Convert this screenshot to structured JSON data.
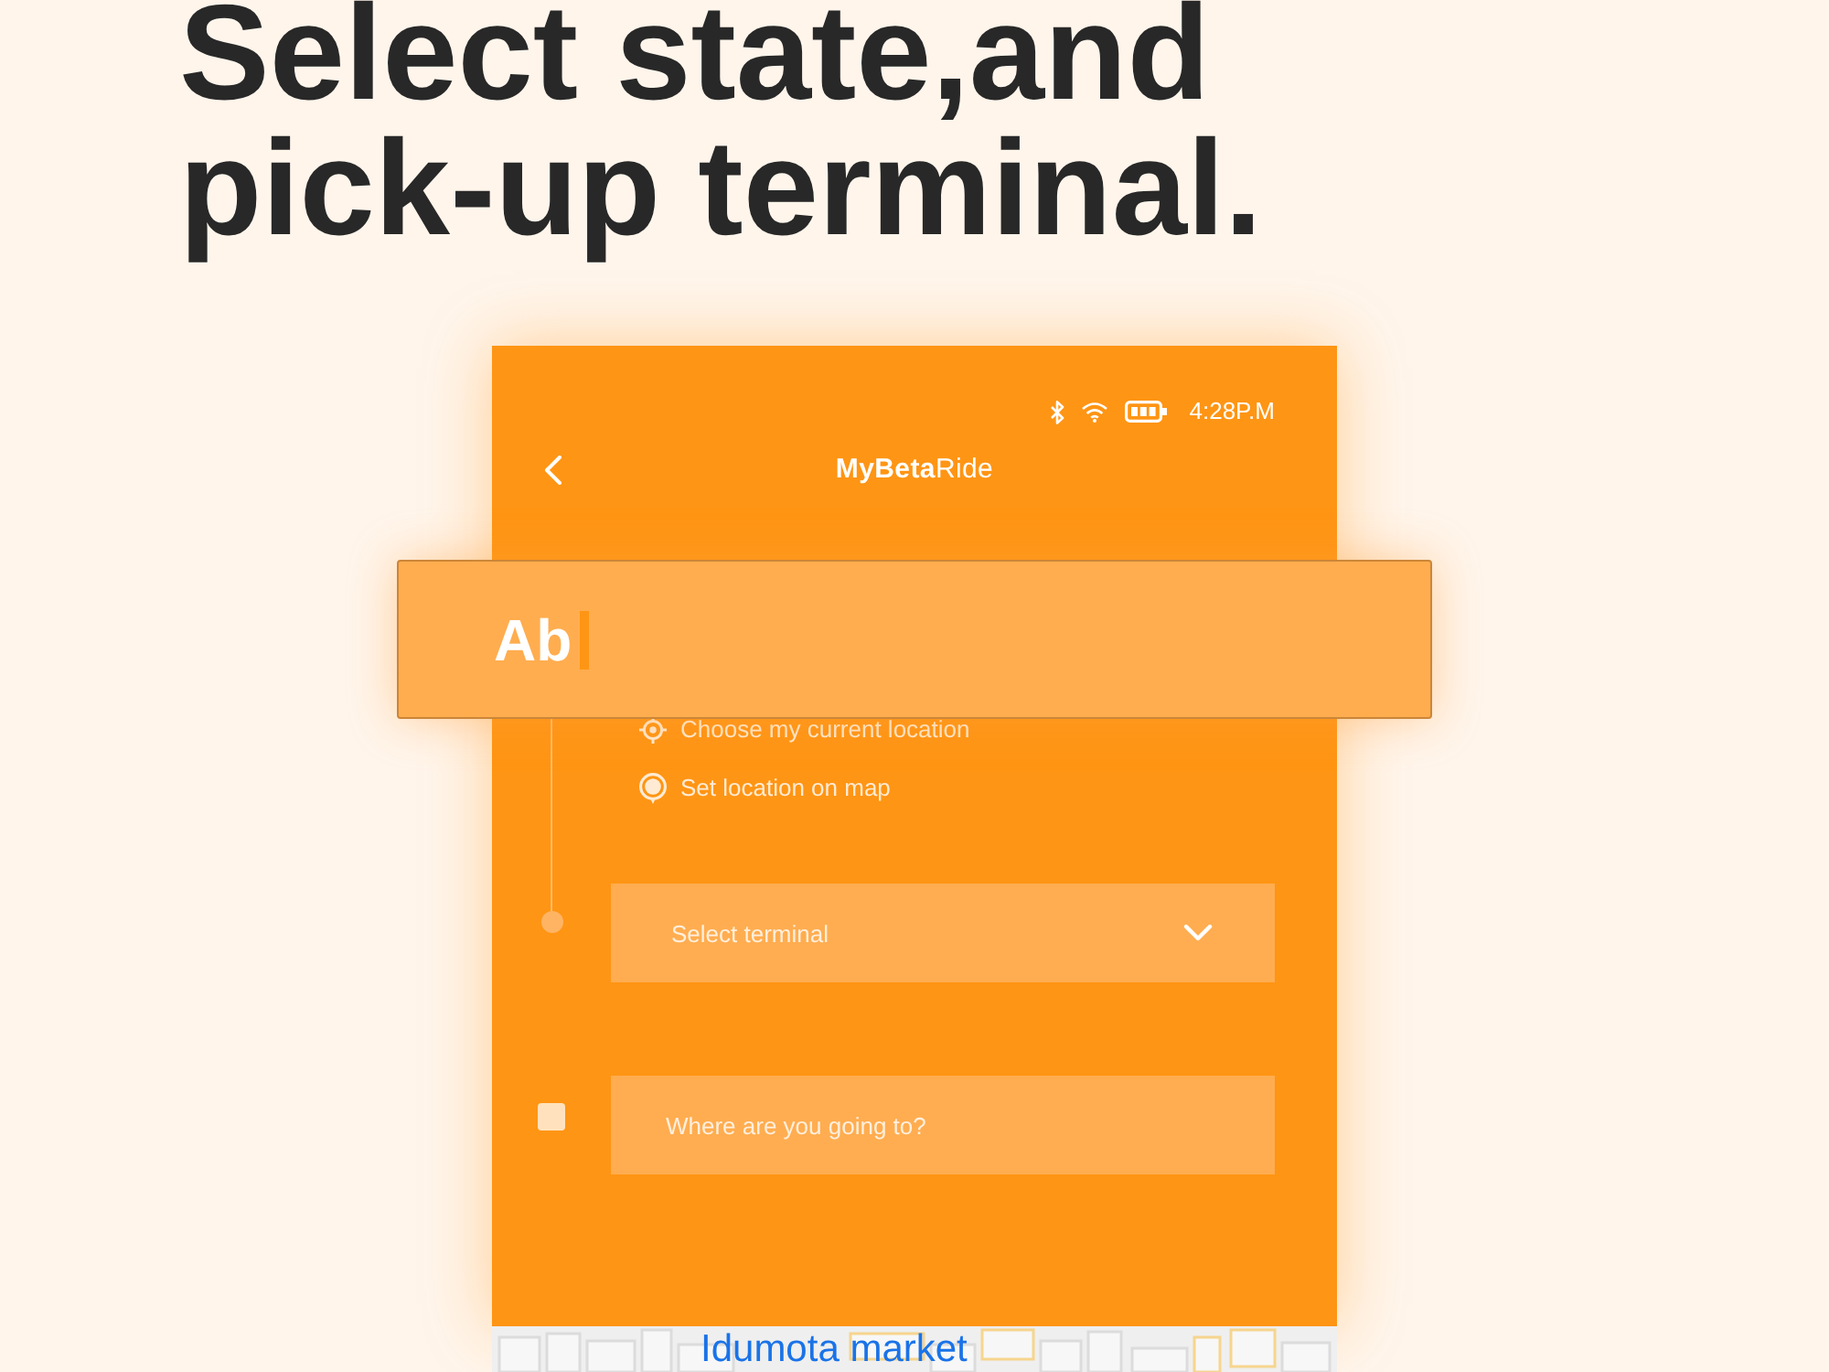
{
  "title": "Select state,and pick-up terminal.",
  "status_bar": {
    "time": "4:28P.M"
  },
  "app_bar": {
    "logo": "**MyBeta**Ride"
  },
  "search_field": {
    "value": "Ab",
    "focused": true
  },
  "location_options": [
    {
      "kind": "current",
      "label": "Choose my current location"
    },
    {
      "kind": "map",
      "label": "Set location on map"
    }
  ],
  "terminal_select": {
    "placeholder": "Select terminal"
  },
  "destination_field": {
    "placeholder": "Where are you going to?"
  },
  "map": {
    "label": "Idumota market"
  }
}
